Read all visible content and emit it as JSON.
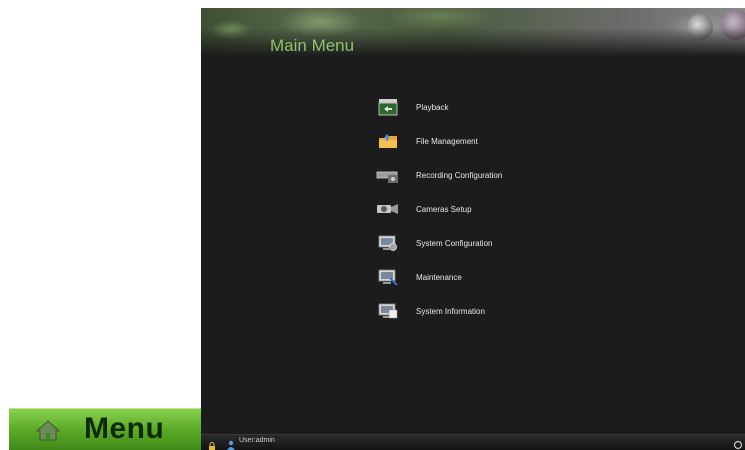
{
  "badge": {
    "label": "Menu",
    "icon": "home-icon"
  },
  "screen": {
    "title": "Main Menu",
    "menu": [
      {
        "label": "Playback",
        "icon": "playback-icon"
      },
      {
        "label": "File Management",
        "icon": "folder-icon"
      },
      {
        "label": "Recording Configuration",
        "icon": "recorder-icon"
      },
      {
        "label": "Cameras Setup",
        "icon": "camera-icon"
      },
      {
        "label": "System Configuration",
        "icon": "monitor-settings-icon"
      },
      {
        "label": "Maintenance",
        "icon": "monitor-tools-icon"
      },
      {
        "label": "System Information",
        "icon": "monitor-info-icon"
      }
    ],
    "status": {
      "user_label": "User:admin"
    }
  },
  "colors": {
    "title": "#8fc36b",
    "badge_green": "#5fae2a",
    "screen_bg": "#1c1c1c"
  }
}
